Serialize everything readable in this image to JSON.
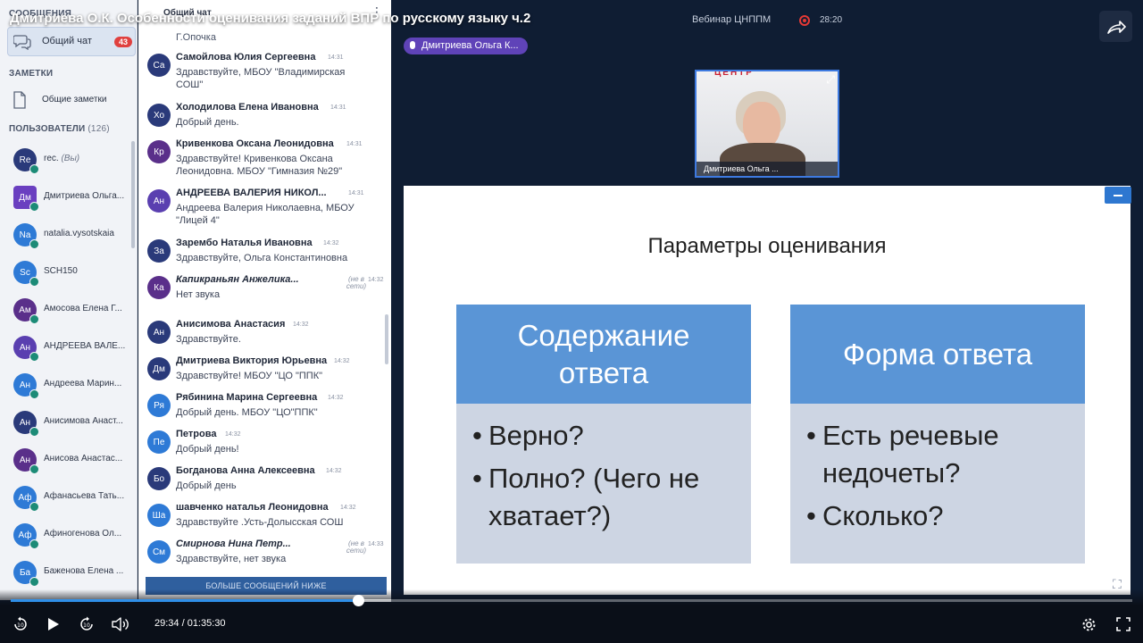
{
  "title": "Дмитриева О.К. Особенности оценивания заданий ВПР по русскому языку ч.2",
  "sidebar": {
    "messages_heading": "СООБЩЕНИЯ",
    "chat_label": "Общий чат",
    "chat_badge": "43",
    "notes_heading": "ЗАМЕТКИ",
    "notes_label": "Общие заметки",
    "users_heading": "ПОЛЬЗОВАТЕЛИ",
    "users_count": "(126)",
    "users": [
      {
        "initials": "Re",
        "name": "rec.",
        "suffix": "(Вы)",
        "color": "#2a3a7a"
      },
      {
        "initials": "Дм",
        "name": "Дмитриева Ольга...",
        "suffix": "",
        "color": "#6a3fc0"
      },
      {
        "initials": "Na",
        "name": "natalia.vysotskaia",
        "suffix": "",
        "color": "#2e7ad6"
      },
      {
        "initials": "Sc",
        "name": "SCH150",
        "suffix": "",
        "color": "#2e7ad6"
      },
      {
        "initials": "Ам",
        "name": "Амосова Елена Г...",
        "suffix": "",
        "color": "#5a2f8a"
      },
      {
        "initials": "Ан",
        "name": "АНДРЕЕВА ВАЛЕ...",
        "suffix": "",
        "color": "#5a3fb0"
      },
      {
        "initials": "Ан",
        "name": "Андреева Марин...",
        "suffix": "",
        "color": "#2e7ad6"
      },
      {
        "initials": "Ан",
        "name": "Анисимова Анаст...",
        "suffix": "",
        "color": "#2a3a7a"
      },
      {
        "initials": "Ан",
        "name": "Анисова Анастас...",
        "suffix": "",
        "color": "#5a2f8a"
      },
      {
        "initials": "Аф",
        "name": "Афанасьева Тать...",
        "suffix": "",
        "color": "#2e7ad6"
      },
      {
        "initials": "Аф",
        "name": "Афиногенова Ол...",
        "suffix": "",
        "color": "#2e7ad6"
      },
      {
        "initials": "Ба",
        "name": "Баженова Елена ...",
        "suffix": "",
        "color": "#2e7ad6"
      }
    ]
  },
  "chat": {
    "title": "Общий чат",
    "lead_text": "Г.Опочка",
    "more_label": "БОЛЬШЕ СООБЩЕНИЙ НИЖЕ",
    "messages": [
      {
        "initials": "Са",
        "author": "Самойлова Юлия Сергеевна",
        "time": "14:31",
        "status": "",
        "text": "Здравствуйте, МБОУ \"Владимирская СОШ\"",
        "color": "#2a3a7a"
      },
      {
        "initials": "Хо",
        "author": "Холодилова Елена Ивановна",
        "time": "14:31",
        "status": "",
        "text": "Добрый день.",
        "color": "#2a3a7a"
      },
      {
        "initials": "Кр",
        "author": "Кривенкова Оксана Леонидовна",
        "time": "14:31",
        "status": "",
        "text": "Здравствуйте! Кривенкова Оксана Леонидовна. МБОУ \"Гимназия №29\"",
        "color": "#5a2f8a"
      },
      {
        "initials": "Ан",
        "author": "АНДРЕЕВА ВАЛЕРИЯ НИКОЛ...",
        "time": "14:31",
        "status": "",
        "text": "Андреева Валерия Николаевна, МБОУ \"Лицей 4\"",
        "color": "#5a3fb0"
      },
      {
        "initials": "За",
        "author": "Зарембо Наталья Ивановна",
        "time": "14:32",
        "status": "",
        "text": "Здравствуйте, Ольга Константиновна",
        "color": "#2a3a7a"
      },
      {
        "initials": "Ка",
        "author": "Капикраньян Анжелика...",
        "time": "14:32",
        "status": "(не в сети)",
        "text": "Нет звука",
        "color": "#5a2f8a"
      },
      {
        "initials": "Ан",
        "author": "Анисимова Анастасия",
        "time": "14:32",
        "status": "",
        "text": "Здравствуйте.",
        "color": "#2a3a7a"
      },
      {
        "initials": "Дм",
        "author": "Дмитриева Виктория Юрьевна",
        "time": "14:32",
        "status": "",
        "text": "Здравствуйте! МБОУ \"ЦО \"ППК\"",
        "color": "#2a3a7a"
      },
      {
        "initials": "Ря",
        "author": "Рябинина Марина Сергеевна",
        "time": "14:32",
        "status": "",
        "text": "Добрый день. МБОУ \"ЦО\"ППК\"",
        "color": "#2e7ad6"
      },
      {
        "initials": "Пе",
        "author": "Петрова",
        "time": "14:32",
        "status": "",
        "text": "Добрый день!",
        "color": "#2e7ad6"
      },
      {
        "initials": "Бо",
        "author": "Богданова Анна Алексеевна",
        "time": "14:32",
        "status": "",
        "text": "Добрый день",
        "color": "#2a3a7a"
      },
      {
        "initials": "Ша",
        "author": "шавченко наталья Леонидовна",
        "time": "14:32",
        "status": "",
        "text": "Здравствуйте .Усть-Долысская СОШ",
        "color": "#2e7ad6"
      },
      {
        "initials": "См",
        "author": "Смирнова Нина Петр...",
        "time": "14:33",
        "status": "(не в сети)",
        "text": "Здравствуйте, нет звука",
        "color": "#2e7ad6"
      }
    ]
  },
  "video": {
    "webinar_label": "Вебинар ЦНППМ",
    "rec_time": "28:20",
    "speaker": "Дмитриева Ольга К...",
    "cam_caption": "Дмитриева Ольга ...",
    "cam_sign": "ЦЕНТР"
  },
  "slide": {
    "title": "Параметры оценивания",
    "boxes": [
      {
        "heading_line1": "Содержание",
        "heading_line2": "ответа",
        "items": [
          "Верно?",
          "Полно? (Чего не хватает?)"
        ]
      },
      {
        "heading_line1": "Форма ответа",
        "heading_line2": "",
        "items": [
          "Есть речевые недочеты?",
          "Сколько?"
        ]
      }
    ]
  },
  "player": {
    "time": "29:34 / 01:35:30",
    "progress": 0.3096,
    "buffered": 0.339,
    "skip_back_label": "10",
    "skip_fwd_label": "10"
  },
  "colors": {
    "accent": "#2f8fe8",
    "speaker_pill": "#5f43b8",
    "slide_heading": "#5a95d6",
    "slide_body": "#cdd5e3",
    "badge": "#e0403e"
  },
  "icons": [
    "chat-bubbles-icon",
    "note-icon",
    "mic-icon",
    "rec-icon",
    "share-icon",
    "expand-icon",
    "play-icon",
    "replay-10-icon",
    "forward-10-icon",
    "volume-icon",
    "settings-icon",
    "fullscreen-icon"
  ]
}
